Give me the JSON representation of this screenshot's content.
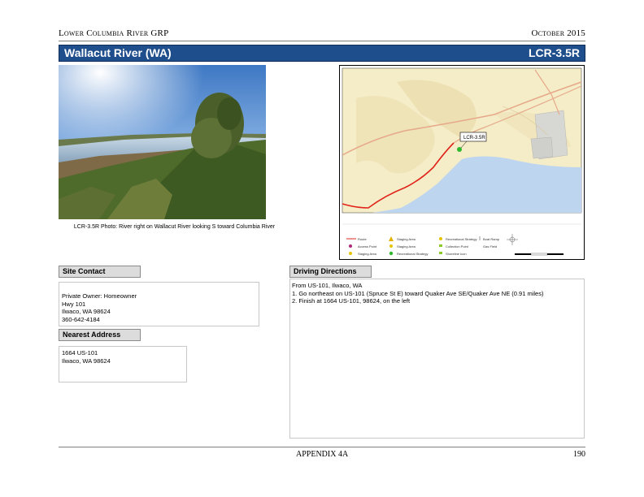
{
  "header": {
    "org": "Lower Columbia River GRP",
    "date": "October 2015"
  },
  "title_bar": {
    "site_name": "Wallacut River (WA)",
    "site_code": "LCR-3.5R"
  },
  "photo": {
    "caption": "LCR-3.5R Photo: River right on Wallacut River looking S toward Columbia River"
  },
  "map": {
    "callout_label": "LCR-3.5R",
    "route_color": "#e0241b",
    "water_color": "#bdd5ee",
    "land_color": "#f5ecc8",
    "legend": {
      "col1": [
        "Route",
        "Access Point",
        "Staging Area"
      ],
      "col2": [
        "Staging Area",
        "Staging Area",
        "Recreational Strategy"
      ],
      "col3": [
        "Recreational Strategy",
        "Collection Point",
        "Shoreline Icon"
      ],
      "col4": [
        "Boat Ramp",
        "Gas Field"
      ]
    }
  },
  "site_contact": {
    "heading": "Site Contact",
    "lines": [
      "Private Owner: Homeowner",
      "Hwy 101",
      "Ilwaco, WA 98624",
      "360-642-4184"
    ]
  },
  "nearest_address": {
    "heading": "Nearest Address",
    "lines": [
      "1664 US-101",
      "Ilwaco, WA 98624"
    ]
  },
  "driving_directions": {
    "heading": "Driving Directions",
    "lines": [
      "From US-101, Ilwaco, WA",
      "1. Go northeast on US-101 (Spruce St E) toward Quaker Ave SE/Quaker Ave NE (0.91 miles)",
      "2. Finish at 1664 US-101, 98624, on the left"
    ]
  },
  "footer": {
    "appendix": "APPENDIX 4A",
    "page": "190"
  }
}
